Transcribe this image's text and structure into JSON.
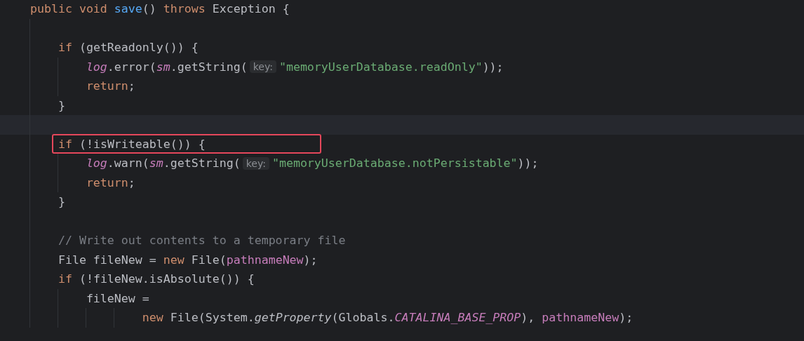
{
  "editor": {
    "lines": [
      {
        "tokens": [
          {
            "text": "    public void ",
            "kind": "kw"
          },
          {
            "text": "save",
            "kind": "decl"
          },
          {
            "text": "() ",
            "kind": "plain"
          },
          {
            "text": "throws ",
            "kind": "kw"
          },
          {
            "text": "Exception {",
            "kind": "plain"
          }
        ],
        "current": false,
        "boxed": false
      },
      {
        "current": false,
        "boxed": false
      },
      {
        "tokens": [
          {
            "text": "        if ",
            "kind": "kw"
          },
          {
            "text": "(getReadonly()) {",
            "kind": "plain"
          }
        ],
        "current": false,
        "boxed": false
      },
      {
        "tokens": [
          {
            "text": "            log",
            "kind": "field"
          },
          {
            "text": ".error(",
            "kind": "plain"
          },
          {
            "text": "sm",
            "kind": "field"
          },
          {
            "text": ".getString(",
            "kind": "plain"
          },
          {
            "text": "key:",
            "kind": "hint"
          },
          {
            "text": "\"memoryUserDatabase.readOnly\"",
            "kind": "str"
          },
          {
            "text": "));",
            "kind": "plain"
          }
        ],
        "current": false,
        "boxed": false
      },
      {
        "tokens": [
          {
            "text": "            return",
            "kind": "kw"
          },
          {
            "text": ";",
            "kind": "plain"
          }
        ],
        "current": false,
        "boxed": false
      },
      {
        "tokens": [
          {
            "text": "        }",
            "kind": "plain"
          }
        ],
        "current": false,
        "boxed": false
      },
      {
        "current": true,
        "boxed": false
      },
      {
        "tokens": [
          {
            "text": "        if ",
            "kind": "kw"
          },
          {
            "text": "(!isWriteable()) {",
            "kind": "plain"
          }
        ],
        "current": false,
        "boxed": true
      },
      {
        "tokens": [
          {
            "text": "            log",
            "kind": "field"
          },
          {
            "text": ".warn(",
            "kind": "plain"
          },
          {
            "text": "sm",
            "kind": "field"
          },
          {
            "text": ".getString(",
            "kind": "plain"
          },
          {
            "text": "key:",
            "kind": "hint"
          },
          {
            "text": "\"memoryUserDatabase.notPersistable\"",
            "kind": "str"
          },
          {
            "text": "));",
            "kind": "plain"
          }
        ],
        "current": false,
        "boxed": false
      },
      {
        "tokens": [
          {
            "text": "            return",
            "kind": "kw"
          },
          {
            "text": ";",
            "kind": "plain"
          }
        ],
        "current": false,
        "boxed": false
      },
      {
        "tokens": [
          {
            "text": "        }",
            "kind": "plain"
          }
        ],
        "current": false,
        "boxed": false
      },
      {
        "current": false,
        "boxed": false
      },
      {
        "tokens": [
          {
            "text": "        // Write out contents to a temporary file",
            "kind": "comment"
          }
        ],
        "current": false,
        "boxed": false
      },
      {
        "tokens": [
          {
            "text": "        File fileNew = ",
            "kind": "plain"
          },
          {
            "text": "new ",
            "kind": "kw"
          },
          {
            "text": "File(",
            "kind": "plain"
          },
          {
            "text": "pathnameNew",
            "kind": "param"
          },
          {
            "text": ");",
            "kind": "plain"
          }
        ],
        "current": false,
        "boxed": false
      },
      {
        "tokens": [
          {
            "text": "        if ",
            "kind": "kw"
          },
          {
            "text": "(!fileNew.isAbsolute()) {",
            "kind": "plain"
          }
        ],
        "current": false,
        "boxed": false
      },
      {
        "tokens": [
          {
            "text": "            fileNew =",
            "kind": "plain"
          }
        ],
        "current": false,
        "boxed": false
      },
      {
        "tokens": [
          {
            "text": "                    new ",
            "kind": "kw"
          },
          {
            "text": "File(System.",
            "kind": "plain"
          },
          {
            "text": "getProperty",
            "kind": "static"
          },
          {
            "text": "(Globals.",
            "kind": "plain"
          },
          {
            "text": "CATALINA_BASE_PROP",
            "kind": "const"
          },
          {
            "text": "), ",
            "kind": "plain"
          },
          {
            "text": "pathnameNew",
            "kind": "param"
          },
          {
            "text": ");",
            "kind": "plain"
          }
        ],
        "current": false,
        "boxed": false
      }
    ]
  }
}
